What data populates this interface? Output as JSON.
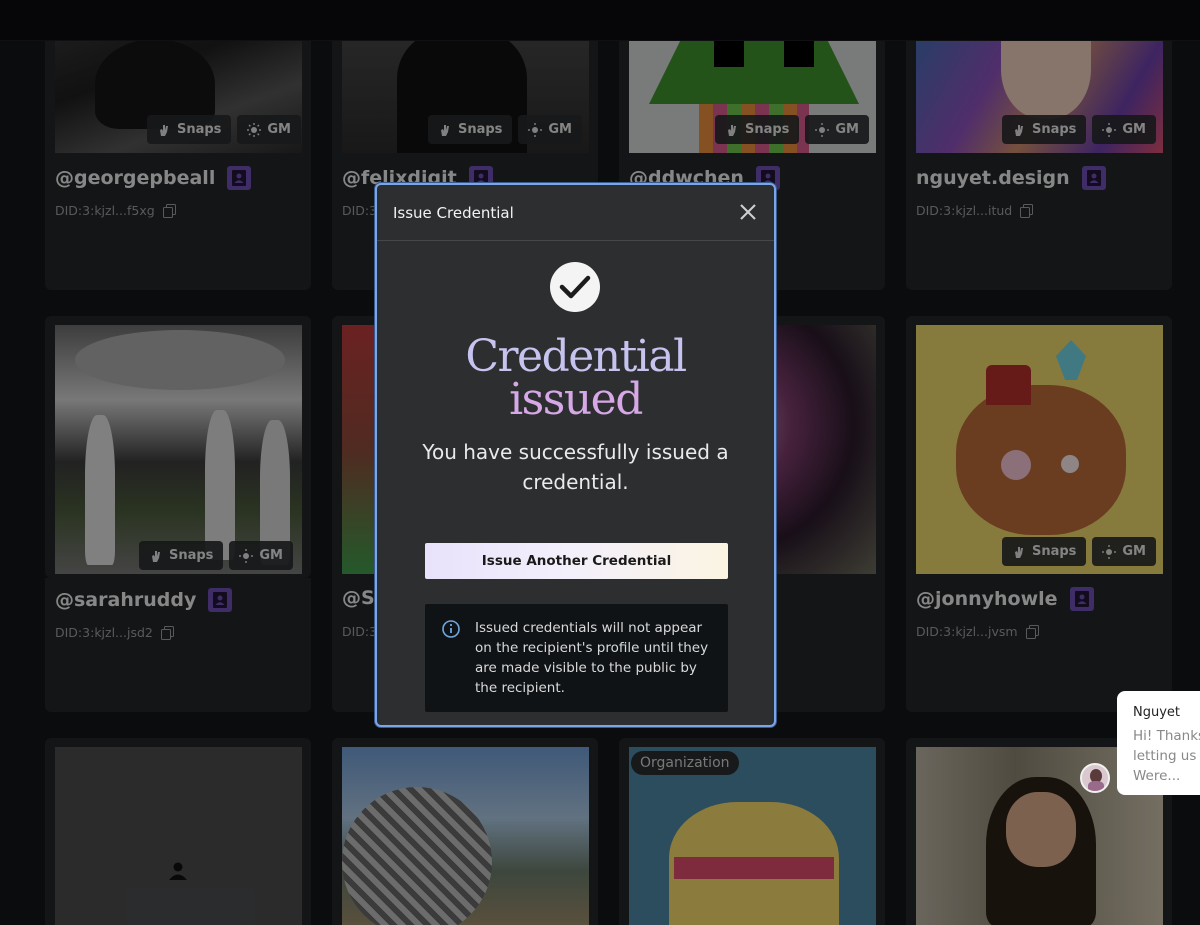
{
  "cards": [
    {
      "handle": "@georgepbeall",
      "did": "DID:3:kjzl...f5xg",
      "show_badges": true
    },
    {
      "handle": "@felixdigit",
      "did": "DID:3",
      "show_badges": true
    },
    {
      "handle": "@ddwchen",
      "did": "",
      "show_badges": true
    },
    {
      "handle": "nguyet.design",
      "did": "DID:3:kjzl...itud",
      "show_badges": true
    },
    {
      "handle": "@sarahruddy",
      "did": "DID:3:kjzl...jsd2",
      "show_badges": true
    },
    {
      "handle": "@S",
      "did": "DID:3",
      "show_badges": false
    },
    {
      "handle": "",
      "did": "",
      "show_badges": false
    },
    {
      "handle": "@jonnyhowle",
      "did": "DID:3:kjzl...jvsm",
      "show_badges": true
    }
  ],
  "badges": {
    "snaps": "Snaps",
    "gm": "GM"
  },
  "org_tag": "Organization",
  "modal": {
    "title": "Issue Credential",
    "headline_line1": "Credential",
    "headline_line2": "issued",
    "message": "You have successfully issued a credential.",
    "button": "Issue Another Credential",
    "info": "Issued credentials will not appear on the recipient's profile until they are made visible to the public by the recipient."
  },
  "chat": {
    "name": "Nguyet",
    "line1": "Hi! Thanks",
    "line2": "letting us k",
    "line3": "Were..."
  },
  "colors": {
    "modal_border": "#7aa6e8",
    "id_badge": "#6b4fb0",
    "headline_top": "#c6c3ef",
    "headline_bottom": "#d6a8e6"
  }
}
